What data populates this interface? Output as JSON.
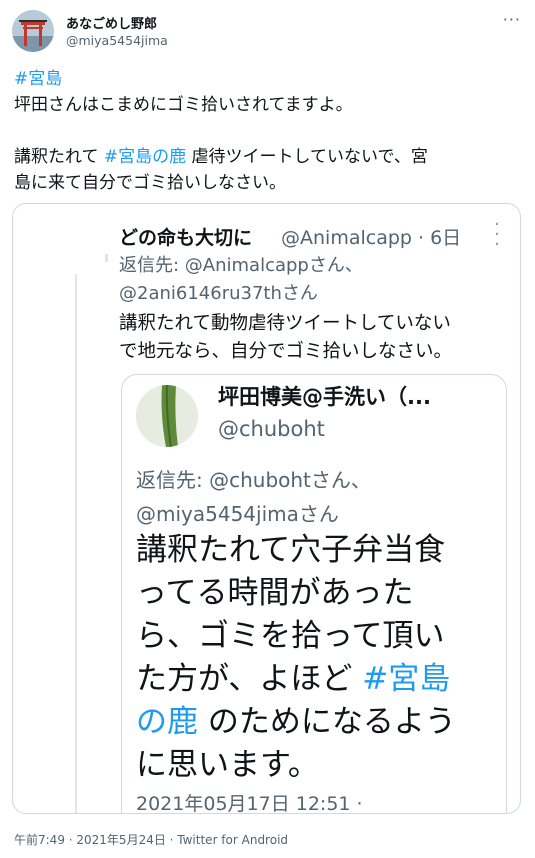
{
  "tweet": {
    "author_name": "あなごめし野郎",
    "author_handle": "@miya5454jima",
    "more_icon": "more-horizontal-icon",
    "text_lines": [
      [
        {
          "t": "#宮島",
          "tag": true
        }
      ],
      [
        {
          "t": "坪田さんはこまめにゴミ拾いされてますよ。",
          "tag": false
        }
      ],
      [],
      [
        {
          "t": "講釈たれて ",
          "tag": false
        },
        {
          "t": "#宮島の鹿",
          "tag": true
        },
        {
          "t": " 虐待ツイートしていないで、宮",
          "tag": false
        }
      ],
      [
        {
          "t": "島に来て自分でゴミ拾いしなさい。",
          "tag": false
        }
      ]
    ],
    "footer": "午前7:49 · 2021年5月24日 · Twitter for Android"
  },
  "screenshot": {
    "tweet": {
      "name": "どの命も大切に",
      "handle_time": "@Animalcapp · 6日",
      "reply_lines": [
        "返信先: @Animalcappさん、",
        "@2ani6146ru37thさん"
      ],
      "body_lines": [
        "講釈たれて動物虐待ツイートしていない",
        "で地元なら、自分でゴミ拾いしなさい。"
      ]
    },
    "quoted": {
      "name": "坪田博美@手洗い（...",
      "handle": "@chuboht",
      "reply_lines": [
        "返信先: @chubohtさん、",
        "@miya5454jimaさん"
      ],
      "body_lines": [
        [
          {
            "t": "講釈たれて穴子弁当食",
            "tag": false
          }
        ],
        [
          {
            "t": "ってる時間があった",
            "tag": false
          }
        ],
        [
          {
            "t": "ら、ゴミを拾って頂い",
            "tag": false
          }
        ],
        [
          {
            "t": "た方が、よほど ",
            "tag": false
          },
          {
            "t": "#宮島",
            "tag": true
          }
        ],
        [
          {
            "t": "の鹿",
            "tag": true
          },
          {
            "t": " のためになるよう",
            "tag": false
          }
        ],
        [
          {
            "t": "に思います。",
            "tag": false
          }
        ]
      ],
      "date": "2021年05月17日 12:51 ·"
    }
  }
}
